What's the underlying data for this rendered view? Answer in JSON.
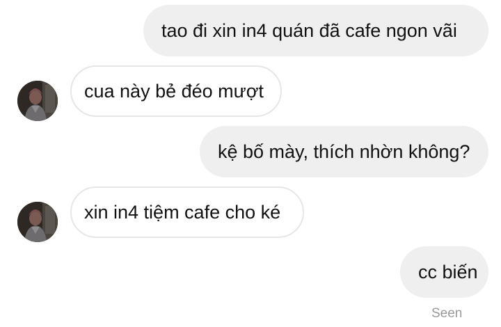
{
  "messages": [
    {
      "sender": "me",
      "text": "tao đi xin in4 quán đã cafe ngon vãi"
    },
    {
      "sender": "other",
      "text": "cua này bẻ đéo mượt"
    },
    {
      "sender": "me",
      "text": "kệ bố mày, thích nhờn không?"
    },
    {
      "sender": "other",
      "text": "xin in4 tiệm cafe cho ké"
    },
    {
      "sender": "me",
      "text": "cc biến"
    }
  ],
  "status": {
    "seen_label": "Seen"
  },
  "colors": {
    "outgoing_bubble": "#efefef",
    "incoming_border": "#e6e6e6",
    "text": "#111111",
    "seen_text": "#9a9a9a"
  },
  "icons": {
    "contact_avatar": "avatar-photo"
  }
}
